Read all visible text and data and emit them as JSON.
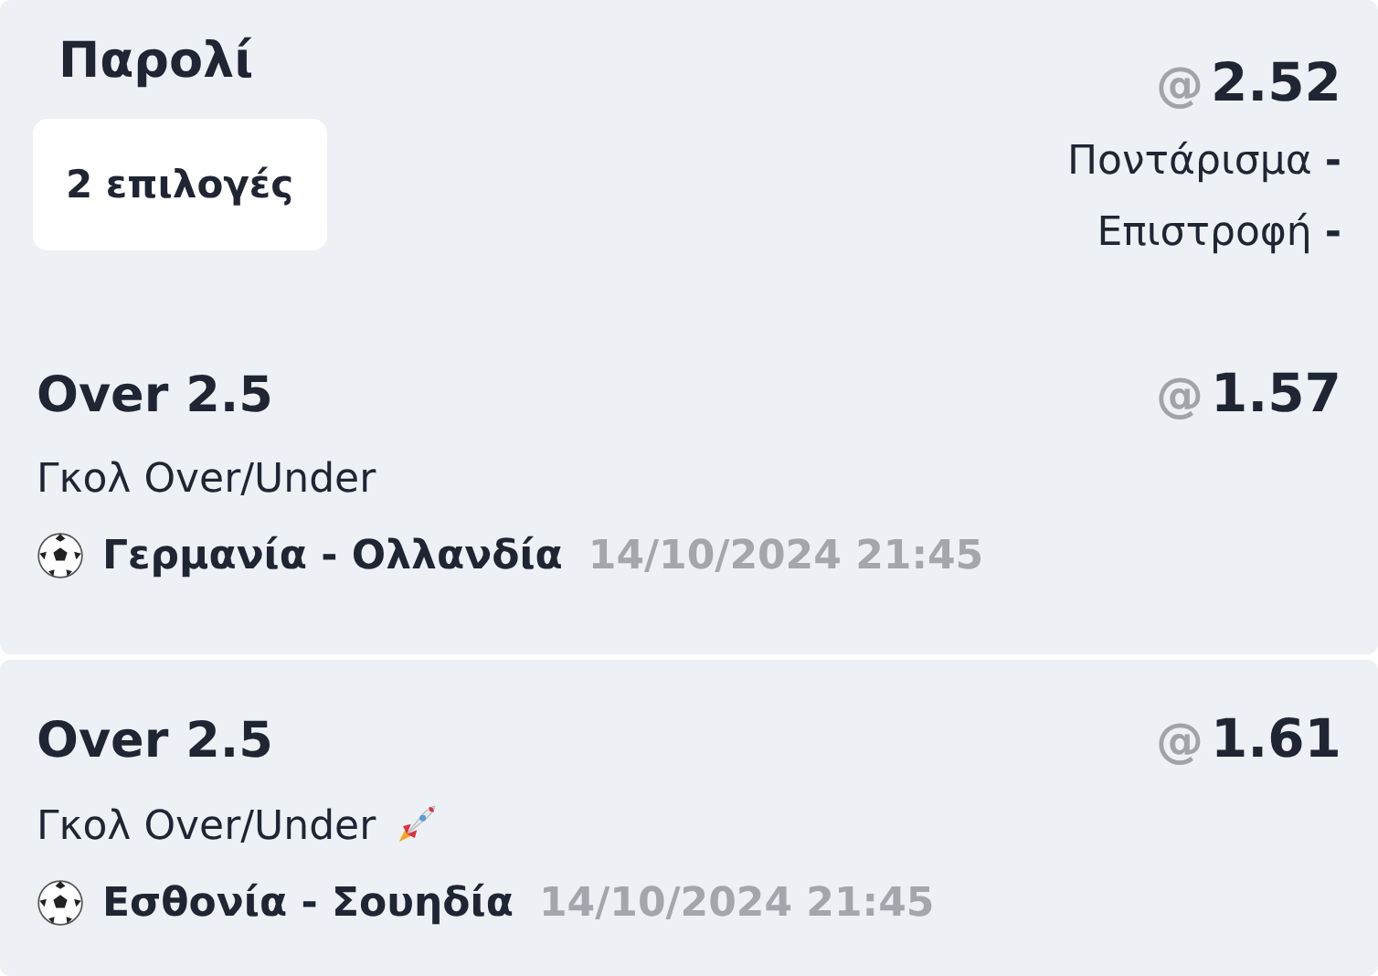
{
  "header": {
    "title": "Παρολί",
    "selections_badge": "2 επιλογές",
    "odds_prefix": "@",
    "odds": "2.52",
    "stake": "Ποντάρισμα **-**",
    "return": "Επιστροφή **-**"
  },
  "selections": [
    {
      "pick": "Over 2.5",
      "odds_prefix": "@",
      "odds": "1.57",
      "market": "Γκολ Over/Under",
      "boosted": false,
      "kind": "football",
      "match": "Γερμανία - Ολλανδία",
      "datetime": "14/10/2024 21:45"
    },
    {
      "pick": "Over 2.5",
      "odds_prefix": "@",
      "odds": "1.61",
      "market": "Γκολ Over/Under",
      "boosted": true,
      "kind": "football",
      "match": "Εσθονία - Σουηδία",
      "datetime": "14/10/2024 21:45"
    }
  ]
}
